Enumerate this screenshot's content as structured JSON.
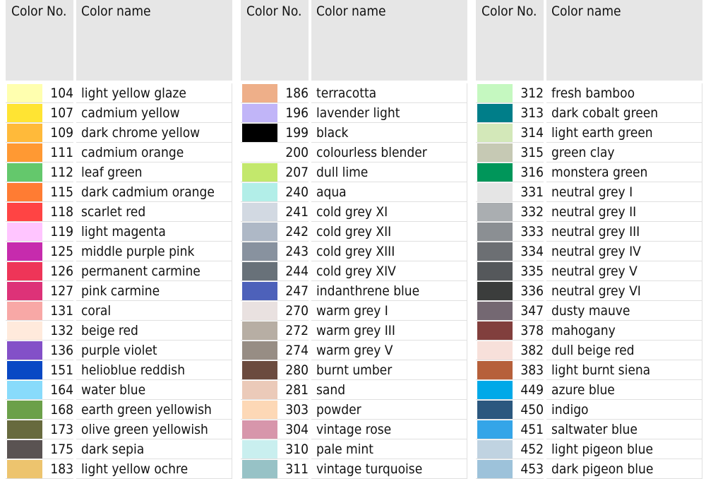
{
  "header": {
    "no_label": "Color No.",
    "name_label": "Color name"
  },
  "columns": [
    {
      "rows": [
        {
          "no": "104",
          "name": "light yellow glaze",
          "color": "#FFFFAF"
        },
        {
          "no": "107",
          "name": "cadmium yellow",
          "color": "#FFE433"
        },
        {
          "no": "109",
          "name": "dark chrome yellow",
          "color": "#FFBA3A"
        },
        {
          "no": "111",
          "name": "cadmium orange",
          "color": "#FF9933"
        },
        {
          "no": "112",
          "name": "leaf green",
          "color": "#64C86C"
        },
        {
          "no": "115",
          "name": "dark cadmium orange",
          "color": "#FF7C33"
        },
        {
          "no": "118",
          "name": "scarlet red",
          "color": "#FF4444"
        },
        {
          "no": "119",
          "name": "light magenta",
          "color": "#FFC5FF"
        },
        {
          "no": "125",
          "name": "middle purple pink",
          "color": "#C62BAD"
        },
        {
          "no": "126",
          "name": "permanent carmine",
          "color": "#EE3558"
        },
        {
          "no": "127",
          "name": "pink carmine",
          "color": "#DD3278"
        },
        {
          "no": "131",
          "name": "coral",
          "color": "#F8A8A6"
        },
        {
          "no": "132",
          "name": "beige red",
          "color": "#FFEADC"
        },
        {
          "no": "136",
          "name": "purple violet",
          "color": "#8350C8"
        },
        {
          "no": "151",
          "name": "helioblue reddish",
          "color": "#0948C4"
        },
        {
          "no": "164",
          "name": "water blue",
          "color": "#88DBFB"
        },
        {
          "no": "168",
          "name": "earth green yellowish",
          "color": "#6BA049"
        },
        {
          "no": "173",
          "name": "olive green yellowish",
          "color": "#676A3E"
        },
        {
          "no": "175",
          "name": "dark sepia",
          "color": "#5A5352"
        },
        {
          "no": "183",
          "name": "light yellow ochre",
          "color": "#EDC46E"
        }
      ]
    },
    {
      "rows": [
        {
          "no": "186",
          "name": "terracotta",
          "color": "#EEAF89"
        },
        {
          "no": "196",
          "name": "lavender light",
          "color": "#C1B5F8"
        },
        {
          "no": "199",
          "name": "black",
          "color": "#000000"
        },
        {
          "no": "200",
          "name": "colourless blender",
          "color": "#FFFFFF"
        },
        {
          "no": "207",
          "name": "dull lime",
          "color": "#C3E86C"
        },
        {
          "no": "240",
          "name": "aqua",
          "color": "#B2EEE8"
        },
        {
          "no": "241",
          "name": "cold grey XI",
          "color": "#D2D9E2"
        },
        {
          "no": "242",
          "name": "cold grey XII",
          "color": "#AEB8C6"
        },
        {
          "no": "243",
          "name": "cold grey XIII",
          "color": "#88929F"
        },
        {
          "no": "244",
          "name": "cold grey XIV",
          "color": "#687179"
        },
        {
          "no": "247",
          "name": "indanthrene blue",
          "color": "#4D61BA"
        },
        {
          "no": "270",
          "name": "warm grey I",
          "color": "#E9E1E0"
        },
        {
          "no": "272",
          "name": "warm grey III",
          "color": "#B7AEA4"
        },
        {
          "no": "274",
          "name": "warm grey V",
          "color": "#978D84"
        },
        {
          "no": "280",
          "name": "burnt umber",
          "color": "#6B4B3F"
        },
        {
          "no": "281",
          "name": "sand",
          "color": "#EBCAB9"
        },
        {
          "no": "303",
          "name": "powder",
          "color": "#FDD8B6"
        },
        {
          "no": "304",
          "name": "vintage rose",
          "color": "#D796AB"
        },
        {
          "no": "310",
          "name": "pale mint",
          "color": "#C9EFEF"
        },
        {
          "no": "311",
          "name": "vintage turquoise",
          "color": "#97C2C6"
        }
      ]
    },
    {
      "rows": [
        {
          "no": "312",
          "name": "fresh bamboo",
          "color": "#C5F8C0"
        },
        {
          "no": "313",
          "name": "dark cobalt green",
          "color": "#007E89"
        },
        {
          "no": "314",
          "name": "light earth green",
          "color": "#D3E8B9"
        },
        {
          "no": "315",
          "name": "green clay",
          "color": "#C6C9B4"
        },
        {
          "no": "316",
          "name": "monstera green",
          "color": "#00965A"
        },
        {
          "no": "331",
          "name": "neutral grey I",
          "color": "#E5E5E5"
        },
        {
          "no": "332",
          "name": "neutral grey II",
          "color": "#AAAEB1"
        },
        {
          "no": "333",
          "name": "neutral grey III",
          "color": "#8B8F93"
        },
        {
          "no": "334",
          "name": "neutral grey IV",
          "color": "#6C6F73"
        },
        {
          "no": "335",
          "name": "neutral grey V",
          "color": "#55585B"
        },
        {
          "no": "336",
          "name": "neutral grey VI",
          "color": "#3B3D3C"
        },
        {
          "no": "347",
          "name": "dusty mauve",
          "color": "#746872"
        },
        {
          "no": "378",
          "name": "mahogany",
          "color": "#813F3D"
        },
        {
          "no": "382",
          "name": "dull beige red",
          "color": "#F7E0DA"
        },
        {
          "no": "383",
          "name": "light burnt siena",
          "color": "#B6603B"
        },
        {
          "no": "449",
          "name": "azure blue",
          "color": "#00A9E8"
        },
        {
          "no": "450",
          "name": "indigo",
          "color": "#2B587F"
        },
        {
          "no": "451",
          "name": "saltwater blue",
          "color": "#34A5E8"
        },
        {
          "no": "452",
          "name": "light pigeon blue",
          "color": "#C0D3E1"
        },
        {
          "no": "453",
          "name": "dark pigeon blue",
          "color": "#9DC2DA"
        }
      ]
    }
  ]
}
